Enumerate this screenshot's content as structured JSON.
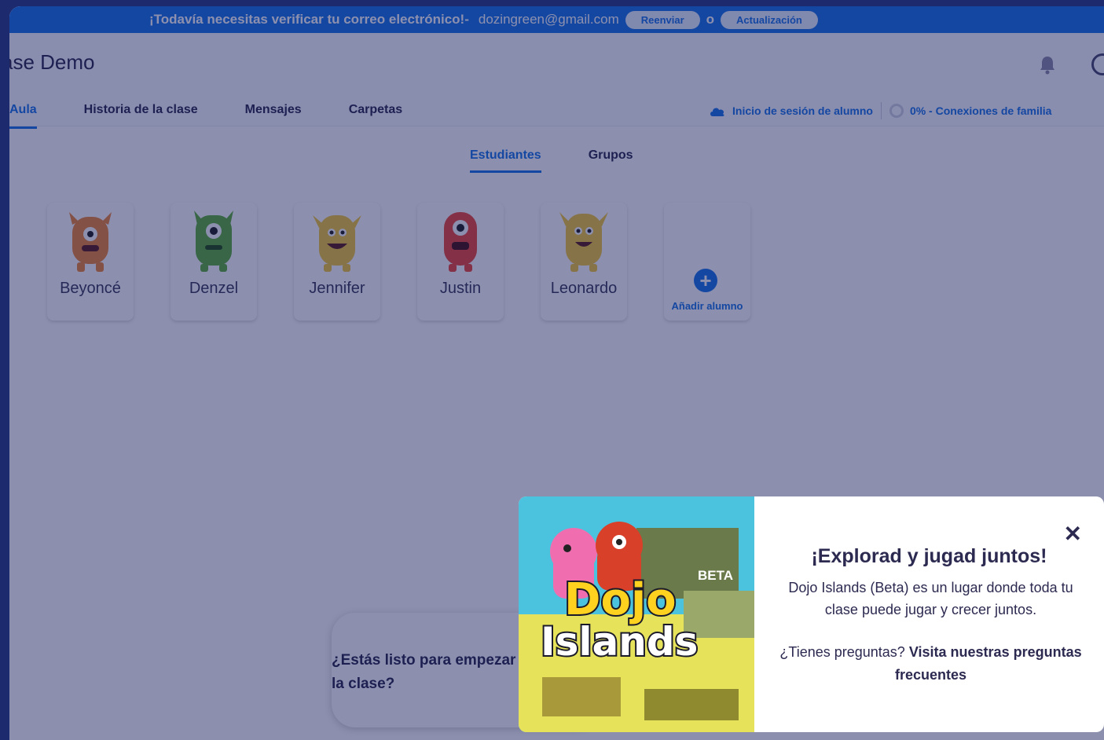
{
  "verify_bar": {
    "message": "¡Todavía necesitas verificar tu correo electrónico!-",
    "email": "dozingreen@gmail.com",
    "resend_label": "Reenviar",
    "or_text": "o",
    "update_label": "Actualización"
  },
  "header": {
    "class_title": "ase Demo",
    "tabs": [
      {
        "label": "Aula"
      },
      {
        "label": "Historia de la clase"
      },
      {
        "label": "Mensajes"
      },
      {
        "label": "Carpetas"
      }
    ],
    "student_login_label": "Inicio de sesión de alumno",
    "family_connections_label": "0% - Conexiones de familia"
  },
  "subtabs": [
    {
      "label": "Estudiantes"
    },
    {
      "label": "Grupos"
    }
  ],
  "students": [
    {
      "name": "Beyoncé",
      "color": "#f0863a"
    },
    {
      "name": "Denzel",
      "color": "#5fae3b"
    },
    {
      "name": "Jennifer",
      "color": "#f3c83a"
    },
    {
      "name": "Justin",
      "color": "#ef4a3c"
    },
    {
      "name": "Leonardo",
      "color": "#f3c83a"
    }
  ],
  "add_student": {
    "label": "Añadir alumno",
    "icon": "plus-icon"
  },
  "ready_card": {
    "text": "¿Estás listo para empezar la clase?"
  },
  "popup": {
    "title": "¡Explorad y jugad juntos!",
    "description": "Dojo Islands (Beta) es un lugar donde toda tu clase puede jugar y crecer juntos.",
    "faq_prefix": "¿Tienes preguntas?",
    "faq_link": "Visita nuestras preguntas frecuentes",
    "close_icon": "close-icon",
    "image_logo_line1": "Dojo",
    "image_logo_line2": "Islands",
    "image_badge": "BETA"
  },
  "colors": {
    "accent": "#1a73e8",
    "overlay": "#0e1656",
    "text": "#2c2a50"
  }
}
